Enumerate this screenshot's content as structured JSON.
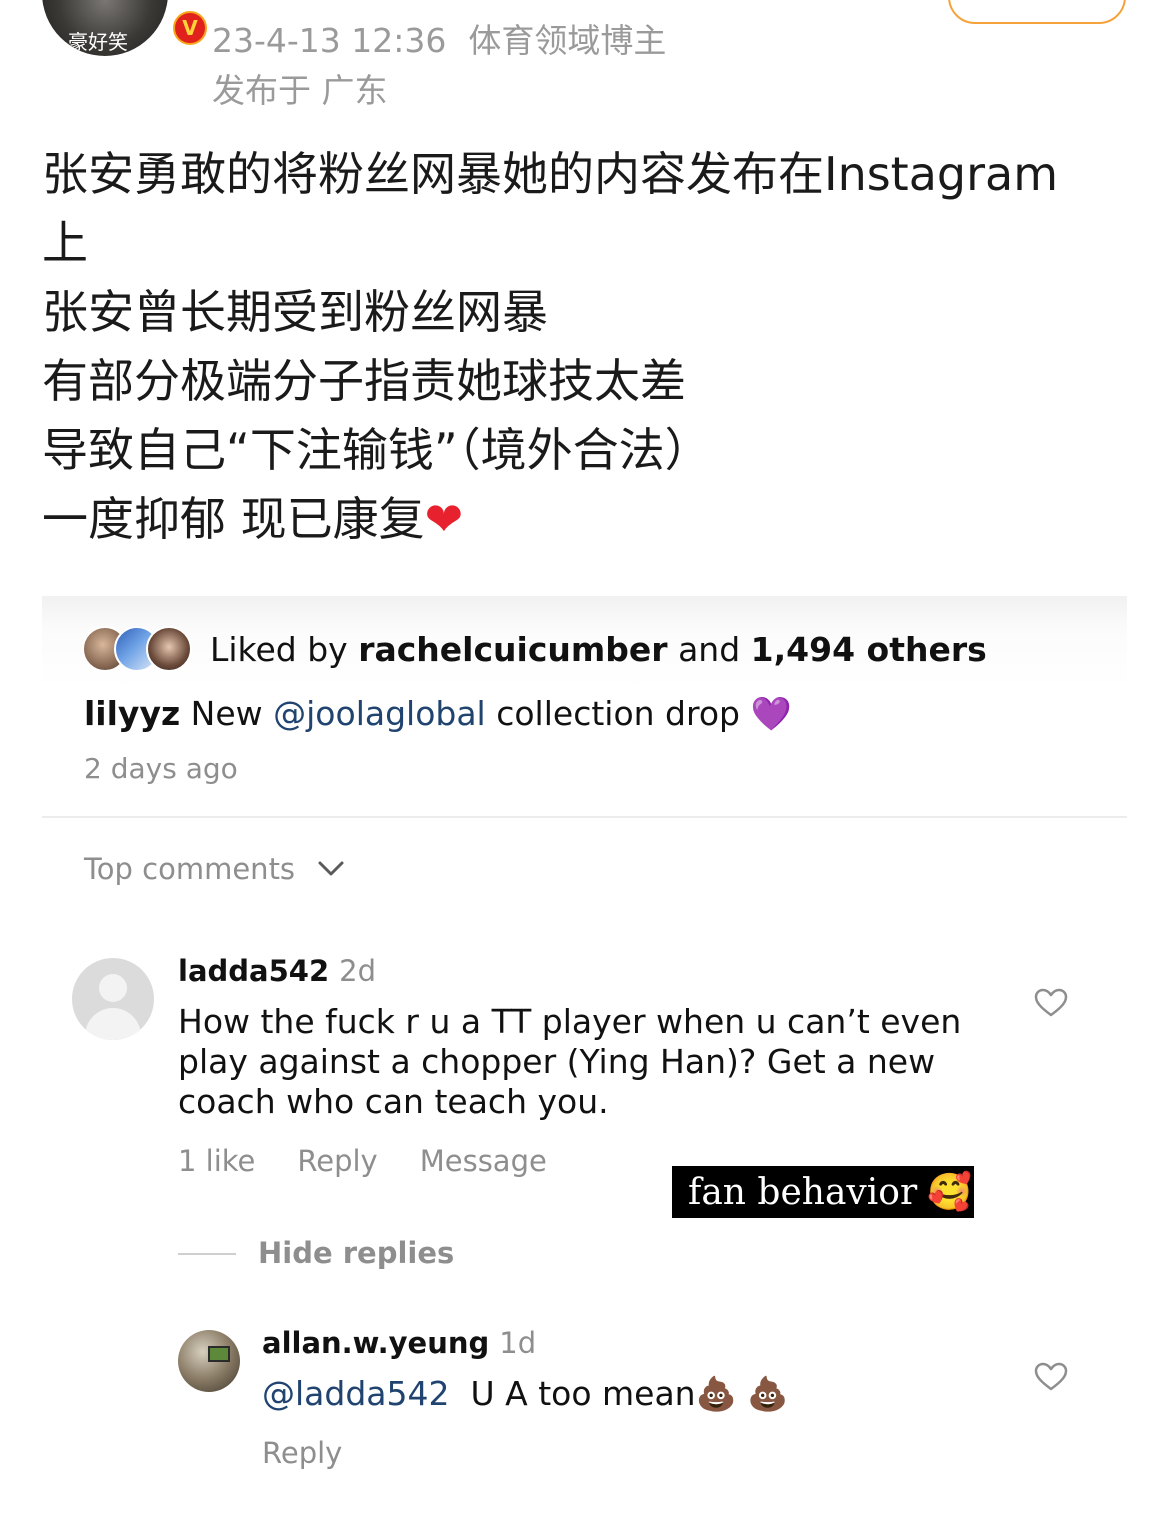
{
  "weibo": {
    "author_avatar_label": "豪好笑",
    "timestamp": "23-4-13 12:36",
    "author_tag": "体育领域博主",
    "location": "发布于 广东",
    "post_lines": [
      "张安勇敢的将粉丝网暴她的内容发布在Instagram",
      "上",
      "张安曾长期受到粉丝网暴",
      "有部分极端分子指责她球技太差",
      "导致自己“下注输钱”（境外合法）",
      "一度抑郁 现已康复"
    ],
    "heart_emoji": "❤"
  },
  "instagram": {
    "likes": {
      "prefix": "Liked by ",
      "user": "rachelcuicumber",
      "middle": " and ",
      "count": "1,494 others"
    },
    "caption": {
      "user": "lilyyz",
      "text_before": " New ",
      "mention": "@joolaglobal",
      "text_after": " collection drop ",
      "emoji": "💜"
    },
    "posted_ago": "2 days ago",
    "top_comments_label": "Top comments",
    "comment": {
      "user": "ladda542",
      "time": "2d",
      "text": "How the fuck r u a TT player when u can’t even play against a chopper (Ying Han)? Get a new coach who can teach you.",
      "likes": "1 like",
      "reply_label": "Reply",
      "message_label": "Message"
    },
    "sticker": {
      "text": "fan behavior",
      "emoji": "🥰"
    },
    "hide_replies_label": "Hide replies",
    "reply": {
      "user": "allan.w.yeung",
      "time": "1d",
      "mention": "@ladda542",
      "text": "U A too mean",
      "emoji": "💩 💩",
      "reply_label": "Reply"
    }
  }
}
